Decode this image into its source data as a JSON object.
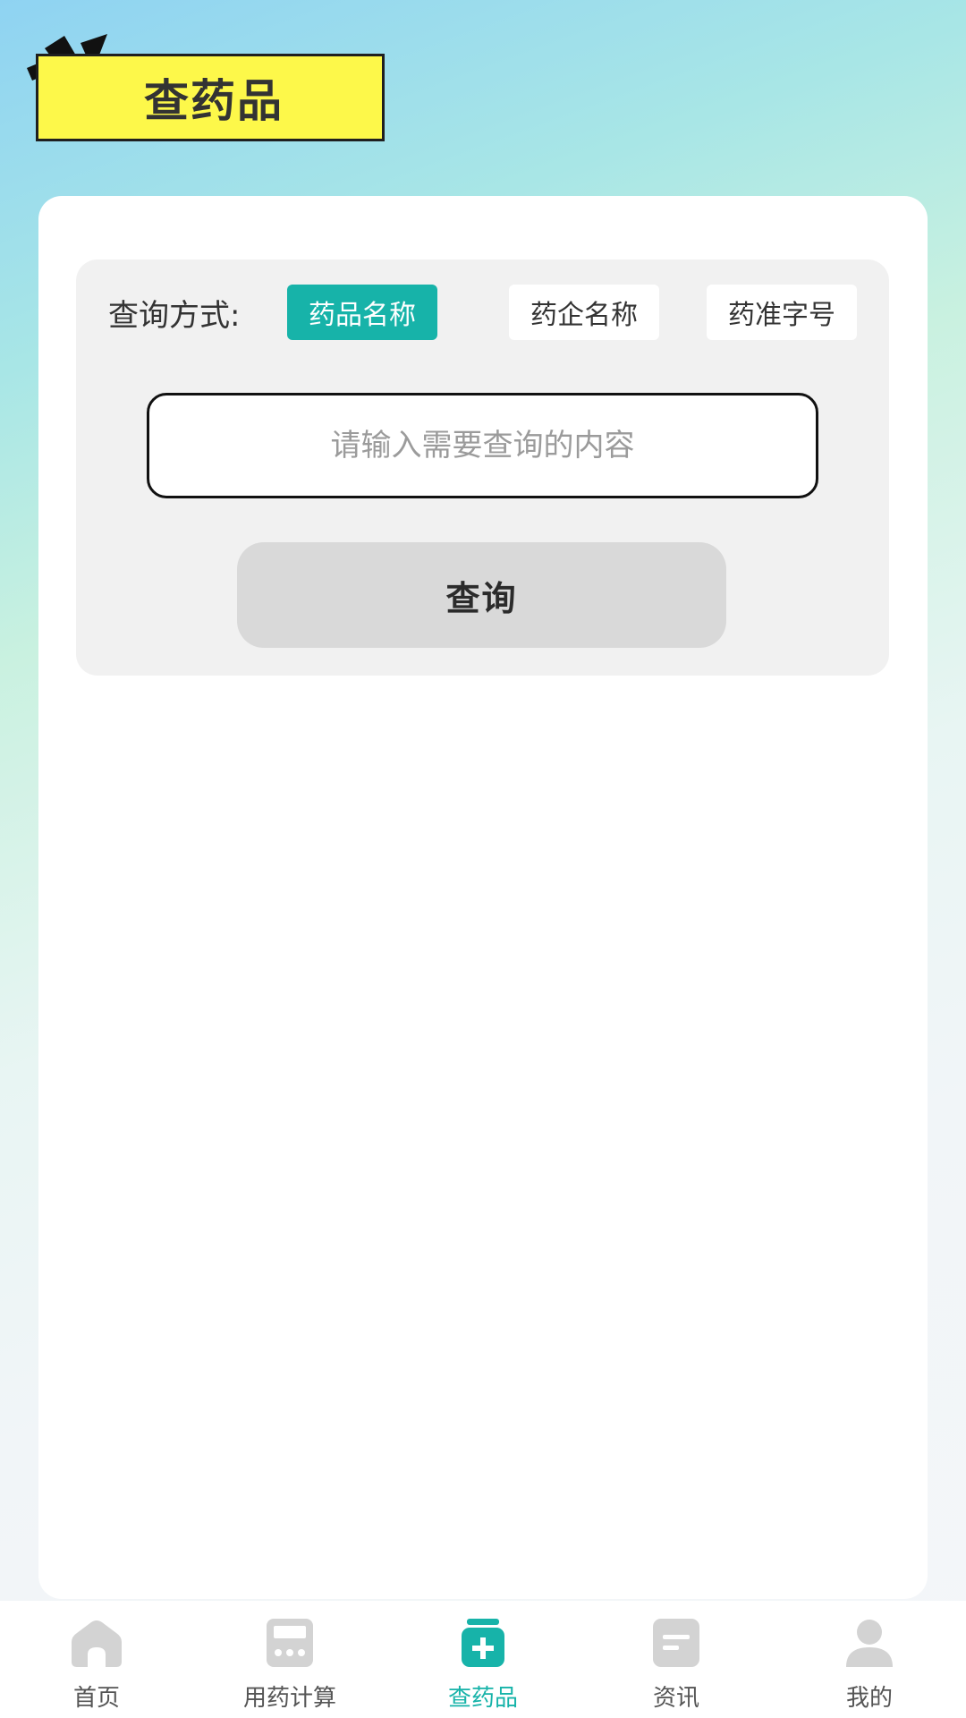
{
  "header": {
    "title": "查药品"
  },
  "search": {
    "mode_label": "查询方式:",
    "modes": [
      {
        "label": "药品名称",
        "active": true
      },
      {
        "label": "药企名称",
        "active": false
      },
      {
        "label": "药准字号",
        "active": false
      }
    ],
    "input_value": "",
    "placeholder": "请输入需要查询的内容",
    "submit_label": "查询"
  },
  "tabbar": {
    "items": [
      {
        "label": "首页",
        "icon": "home-icon",
        "active": false
      },
      {
        "label": "用药计算",
        "icon": "calculator-icon",
        "active": false
      },
      {
        "label": "查药品",
        "icon": "medicine-bottle-icon",
        "active": true
      },
      {
        "label": "资讯",
        "icon": "news-icon",
        "active": false
      },
      {
        "label": "我的",
        "icon": "profile-icon",
        "active": false
      }
    ]
  },
  "colors": {
    "accent": "#17b3a9",
    "badge": "#fdf84a",
    "icon_inactive": "#d3d3d3"
  }
}
